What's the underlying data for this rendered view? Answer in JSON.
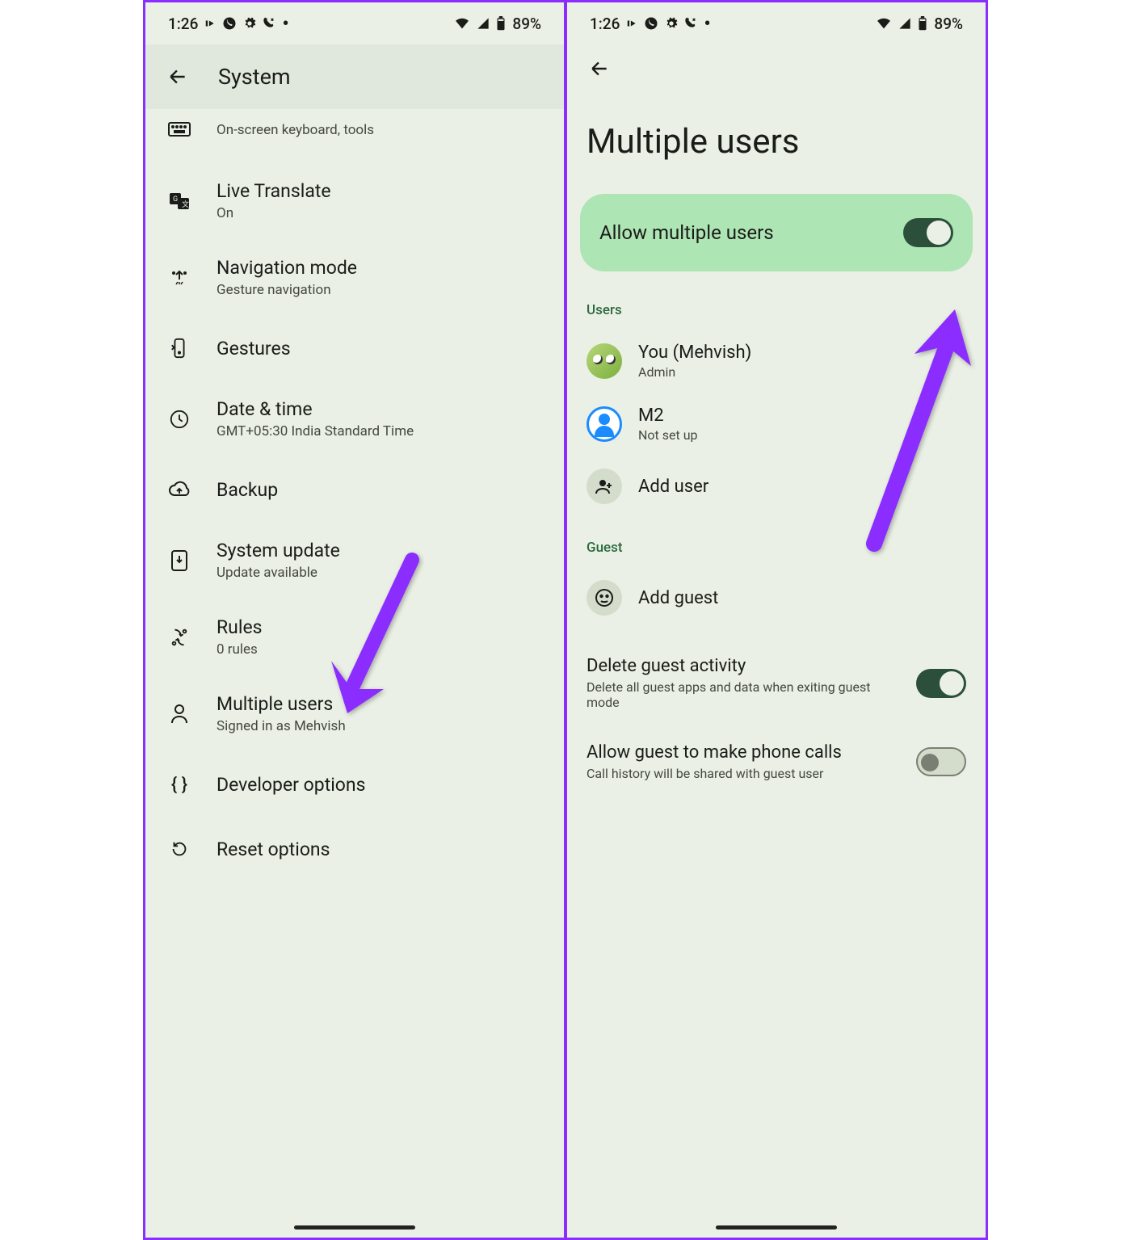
{
  "statusbar": {
    "time": "1:26",
    "battery": "89%"
  },
  "left": {
    "header": "System",
    "items": [
      {
        "title": "",
        "sub": "On-screen keyboard, tools",
        "icon": "keyboard"
      },
      {
        "title": "Live Translate",
        "sub": "On",
        "icon": "translate"
      },
      {
        "title": "Navigation mode",
        "sub": "Gesture navigation",
        "icon": "nav"
      },
      {
        "title": "Gestures",
        "sub": "",
        "icon": "gesture"
      },
      {
        "title": "Date & time",
        "sub": "GMT+05:30 India Standard Time",
        "icon": "clock"
      },
      {
        "title": "Backup",
        "sub": "",
        "icon": "cloud"
      },
      {
        "title": "System update",
        "sub": "Update available",
        "icon": "update"
      },
      {
        "title": "Rules",
        "sub": "0 rules",
        "icon": "rules"
      },
      {
        "title": "Multiple users",
        "sub": "Signed in as Mehvish",
        "icon": "person"
      },
      {
        "title": "Developer options",
        "sub": "",
        "icon": "dev"
      },
      {
        "title": "Reset options",
        "sub": "",
        "icon": "reset"
      }
    ]
  },
  "right": {
    "title": "Multiple users",
    "toggle": {
      "label": "Allow multiple users",
      "on": true
    },
    "users_label": "Users",
    "users": [
      {
        "name": "You (Mehvish)",
        "sub": "Admin",
        "avatar": "green"
      },
      {
        "name": "M2",
        "sub": "Not set up",
        "avatar": "blue"
      },
      {
        "name": "Add user",
        "sub": "",
        "avatar": "add"
      }
    ],
    "guest_label": "Guest",
    "guest_action": "Add guest",
    "settings": [
      {
        "title": "Delete guest activity",
        "sub": "Delete all guest apps and data when exiting guest mode",
        "on": true
      },
      {
        "title": "Allow guest to make phone calls",
        "sub": "Call history will be shared with guest user",
        "on": false
      }
    ]
  }
}
